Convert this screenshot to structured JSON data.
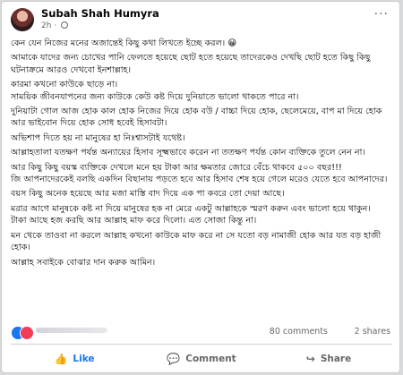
{
  "post": {
    "author": "Subah Shah Humyra",
    "time": "2h",
    "more": "···",
    "paragraphs": [
      "কেন যেন নিজের মনের অজান্তেই কিছু কথা লিখতে ইচ্ছে করল। 😀",
      "আমাকে যাদের জন্য চোখের পানি ফেলতে হয়েছে ছোট হতে হয়েছে তাদেরকেও দেখছি ছোট হতে কিছু কিছু ঘটনাক্রমে আরও দেখবো ইনশাল্লাহ।",
      "কারমা কখনো কাউকে ছাড়ে না।",
      "সাময়িক জীবনযাপনের জন্য কাউকে কেউ কষ্ট দিয়ে দুনিয়াতে ভালো থাকতে পারে না।",
      "দুনিয়াটা গোল আজ হোক কাল হোক নিজের দিয়ে হোক বউ / বাচ্চা দিয়ে হোক, ছেলেমেয়ে, বাপ মা দিয়ে হোক আর ভাইবোন দিয়ে হোক সোধ হবেই হিসাবটা।",
      "অভিশাপ দিতে হয় না মানুষের হা নিঃশ্বাসটাই যথেষ্ট।",
      "আল্লাহতালা যতক্ষণ পর্যন্ত অন্যায়ের হিসাব সূক্ষ্মভাবে করেন না ততক্ষণ পর্যন্ত কোন ব্যক্তিকে তুলে নেন না।",
      "আর কিছু কিছু বয়স্ক ব্যক্তিকে দেখলে মনে হয় টাকা আর ক্ষমতার জোরে বেঁচে থাকবে ৫০০ বছর!!!",
      "জি আপনাদেরকেই বলছি একদিন বিছানায় পড়তে হবে আর হিসাব শেষ হয়ে গেলে মরেও যেতে হবে আপনাদের।",
      "বয়স কিছু অনেক হয়েছে আর মজা মাস্তি বাদ দিয়ে এক পা কবরে তো দেয়া আছে।",
      "মরার আগে মানুষকে কষ্ট না দিয়ে মানুষের হক না মেরে একটু আল্লাহকে স্মরণ করুন এবং ভালো হয়ে থাকুন।",
      "টাকা আছে হজ করছি আর আল্লাহ মাফ করে দিলো। এত সোজা কিন্তু না।",
      "মন থেকে তাওবা না করলে আল্লাহ কখনো কাউকে মাফ করে না সে যতো বড় নামাজী হোক আর যত বড় হাজী হোক।",
      "আল্লাহ সবাইকে বোঝার দান করুক আমিন।"
    ]
  },
  "stats": {
    "comments": "80 comments",
    "shares": "2 shares"
  },
  "actions": {
    "like": "Like",
    "comment": "Comment",
    "share": "Share"
  },
  "colors": {
    "accent": "#1877f2",
    "text": "#050505",
    "muted": "#65676b"
  }
}
